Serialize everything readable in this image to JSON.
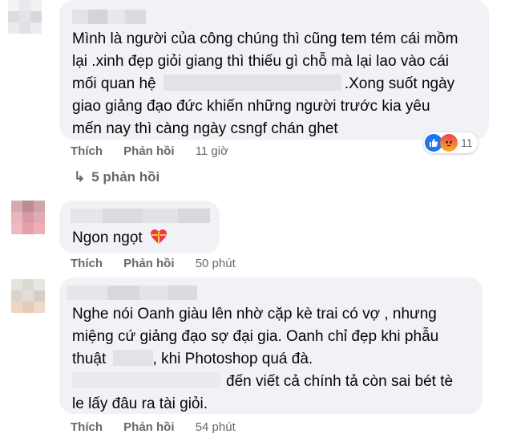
{
  "comments": [
    {
      "lines": [
        "Mình là người của công chúng thì cũng tem tém cái mồm",
        "lại .xinh đẹp giỏi giang thì thiếu gì chỗ mà lại lao vào cái",
        "mối quan hệ",
        ".Xong suốt ngày",
        "giao giảng đạo đức khiến những người trước kia yêu",
        "mến nay thì càng ngày csngf chán ghet"
      ],
      "like_label": "Thích",
      "reply_label": "Phản hồi",
      "time": "11 giờ",
      "reaction_count": "11",
      "replies_label": "5 phản hồi"
    },
    {
      "lines": [
        "Ngon ngọt"
      ],
      "like_label": "Thích",
      "reply_label": "Phản hồi",
      "time": "50 phút"
    },
    {
      "lines": [
        "Nghe nói Oanh giàu lên nhờ cặp kè trai có vợ , nhưng",
        "miệng cứ giảng đạo sợ đại gia. Oanh chỉ đẹp khi phẫu",
        "thuật",
        ", khi Photoshop quá đà.",
        "đến viết cả chính tả còn sai bét tè",
        "le lấy đâu ra tài giỏi."
      ],
      "like_label": "Thích",
      "reply_label": "Phản hồi",
      "time": "54 phút"
    }
  ],
  "colors": {
    "bubble": "#f0f2f5",
    "meta_text": "#65676b",
    "like_blue": "#1877f2"
  },
  "icons": {
    "like": "thumbs-up-icon",
    "angry": "angry-face-icon",
    "reply_arrow": "reply-arrow-icon",
    "heart": "heart-gift-icon"
  }
}
